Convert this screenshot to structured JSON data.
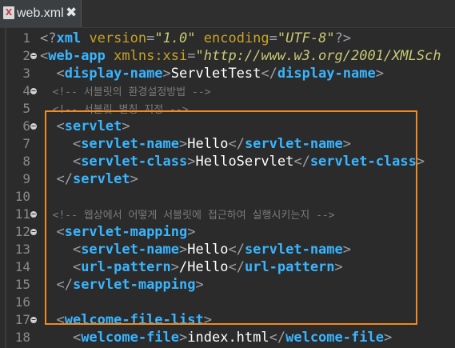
{
  "tab": {
    "icon": "xml-file-icon",
    "title": "web.xml",
    "close": "✖"
  },
  "lines": [
    {
      "n": "1",
      "fold": false
    },
    {
      "n": "2",
      "fold": true
    },
    {
      "n": "3",
      "fold": false
    },
    {
      "n": "4",
      "fold": true
    },
    {
      "n": "5",
      "fold": false
    },
    {
      "n": "6",
      "fold": true
    },
    {
      "n": "7",
      "fold": false
    },
    {
      "n": "8",
      "fold": false
    },
    {
      "n": "9",
      "fold": false
    },
    {
      "n": "10",
      "fold": false
    },
    {
      "n": "11",
      "fold": true
    },
    {
      "n": "12",
      "fold": true
    },
    {
      "n": "13",
      "fold": false
    },
    {
      "n": "14",
      "fold": false
    },
    {
      "n": "15",
      "fold": false
    },
    {
      "n": "16",
      "fold": false
    },
    {
      "n": "17",
      "fold": true
    },
    {
      "n": "18",
      "fold": false
    }
  ],
  "code": {
    "l1": {
      "p1": "<?",
      "t": "xml",
      "a1": " version",
      "eq1": "=",
      "s1": "\"1.0\"",
      "a2": " encoding",
      "eq2": "=",
      "s2": "\"UTF-8\"",
      "p2": "?>"
    },
    "l2": {
      "p1": "<",
      "t": "web-app",
      "a1": " xmlns:xsi",
      "eq": "=",
      "s": "\"http://www.w3.org/2001/XMLSch"
    },
    "l3": {
      "p1": "  <",
      "t1": "display-name",
      "p2": ">",
      "x": "ServletTest",
      "p3": "</",
      "t2": "display-name",
      "p4": ">"
    },
    "l4": {
      "c": "  <!-- 서블릿의 환경설정방법 -->"
    },
    "l5": {
      "c": "  <!-- 서블릿 별칭 지정 -->"
    },
    "l6": {
      "p1": "  <",
      "t": "servlet",
      "p2": ">"
    },
    "l7": {
      "p1": "    <",
      "t1": "servlet-name",
      "p2": ">",
      "x": "Hello",
      "p3": "</",
      "t2": "servlet-name",
      "p4": ">"
    },
    "l8": {
      "p1": "    <",
      "t1": "servlet-class",
      "p2": ">",
      "x": "HelloServlet",
      "p3": "</",
      "t2": "servlet-class",
      "p4": ">"
    },
    "l9": {
      "p1": "  </",
      "t": "servlet",
      "p2": ">"
    },
    "l10": {},
    "l11": {
      "c": "  <!-- 웹상에서 어떻게 서블릿에 접근하여 실행시키는지 -->"
    },
    "l12": {
      "p1": "  <",
      "t": "servlet-mapping",
      "p2": ">"
    },
    "l13": {
      "p1": "    <",
      "t1": "servlet-name",
      "p2": ">",
      "x": "Hello",
      "p3": "</",
      "t2": "servlet-name",
      "p4": ">"
    },
    "l14": {
      "p1": "    <",
      "t1": "url-pattern",
      "p2": ">",
      "x": "/Hello",
      "p3": "</",
      "t2": "url-pattern",
      "p4": ">"
    },
    "l15": {
      "p1": "  </",
      "t": "servlet-mapping",
      "p2": ">"
    },
    "l16": {},
    "l17": {
      "p1": "  <",
      "t": "welcome-file-list",
      "p2": ">"
    },
    "l18": {
      "p1": "    <",
      "t1": "welcome-file",
      "p2": ">",
      "x": "index.html",
      "p3": "</",
      "t2": "welcome-file",
      "p4": ">"
    }
  },
  "colors": {
    "highlight_box": "#f08a24",
    "tag": "#39b5ff",
    "string": "#c9c975",
    "comment": "#7a7a7a"
  }
}
